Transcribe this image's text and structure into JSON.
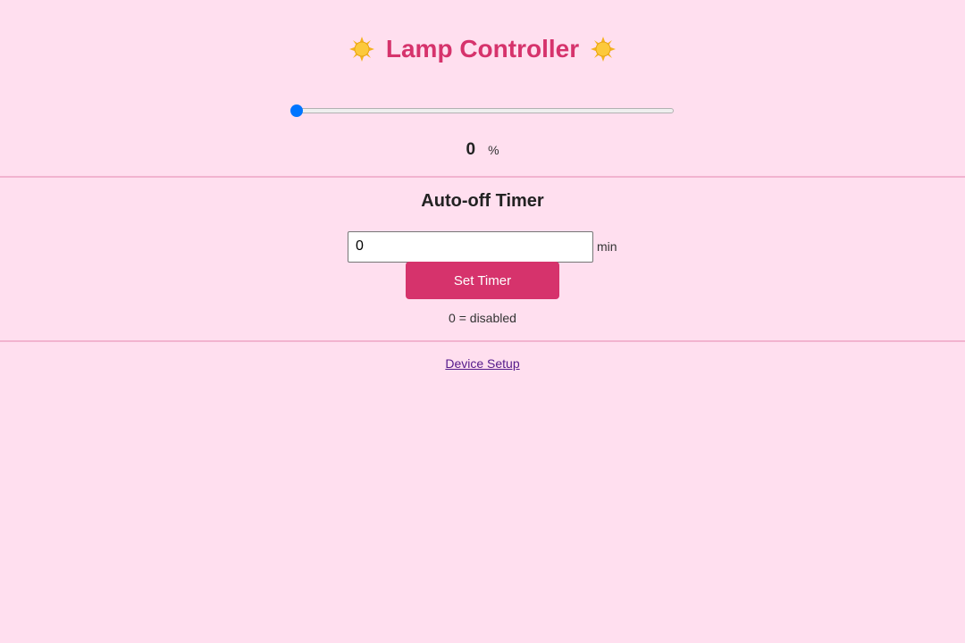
{
  "header": {
    "title": "Lamp Controller",
    "left_icon": "sun-icon",
    "right_icon": "sun-icon",
    "title_color": "#d6336c"
  },
  "brightness": {
    "slider_value": 0,
    "slider_max": 100,
    "value_text": "0",
    "unit": "%"
  },
  "timer": {
    "heading": "Auto-off Timer",
    "input_value": "0",
    "input_unit": "min",
    "button_label": "Set Timer",
    "hint": "0 = disabled",
    "button_color": "#d6336c"
  },
  "footer": {
    "link_label": "Device Setup"
  },
  "colors": {
    "background": "#ffdfef",
    "accent": "#d6336c",
    "slider": "#0075ff",
    "divider": "#f2b3cf"
  }
}
